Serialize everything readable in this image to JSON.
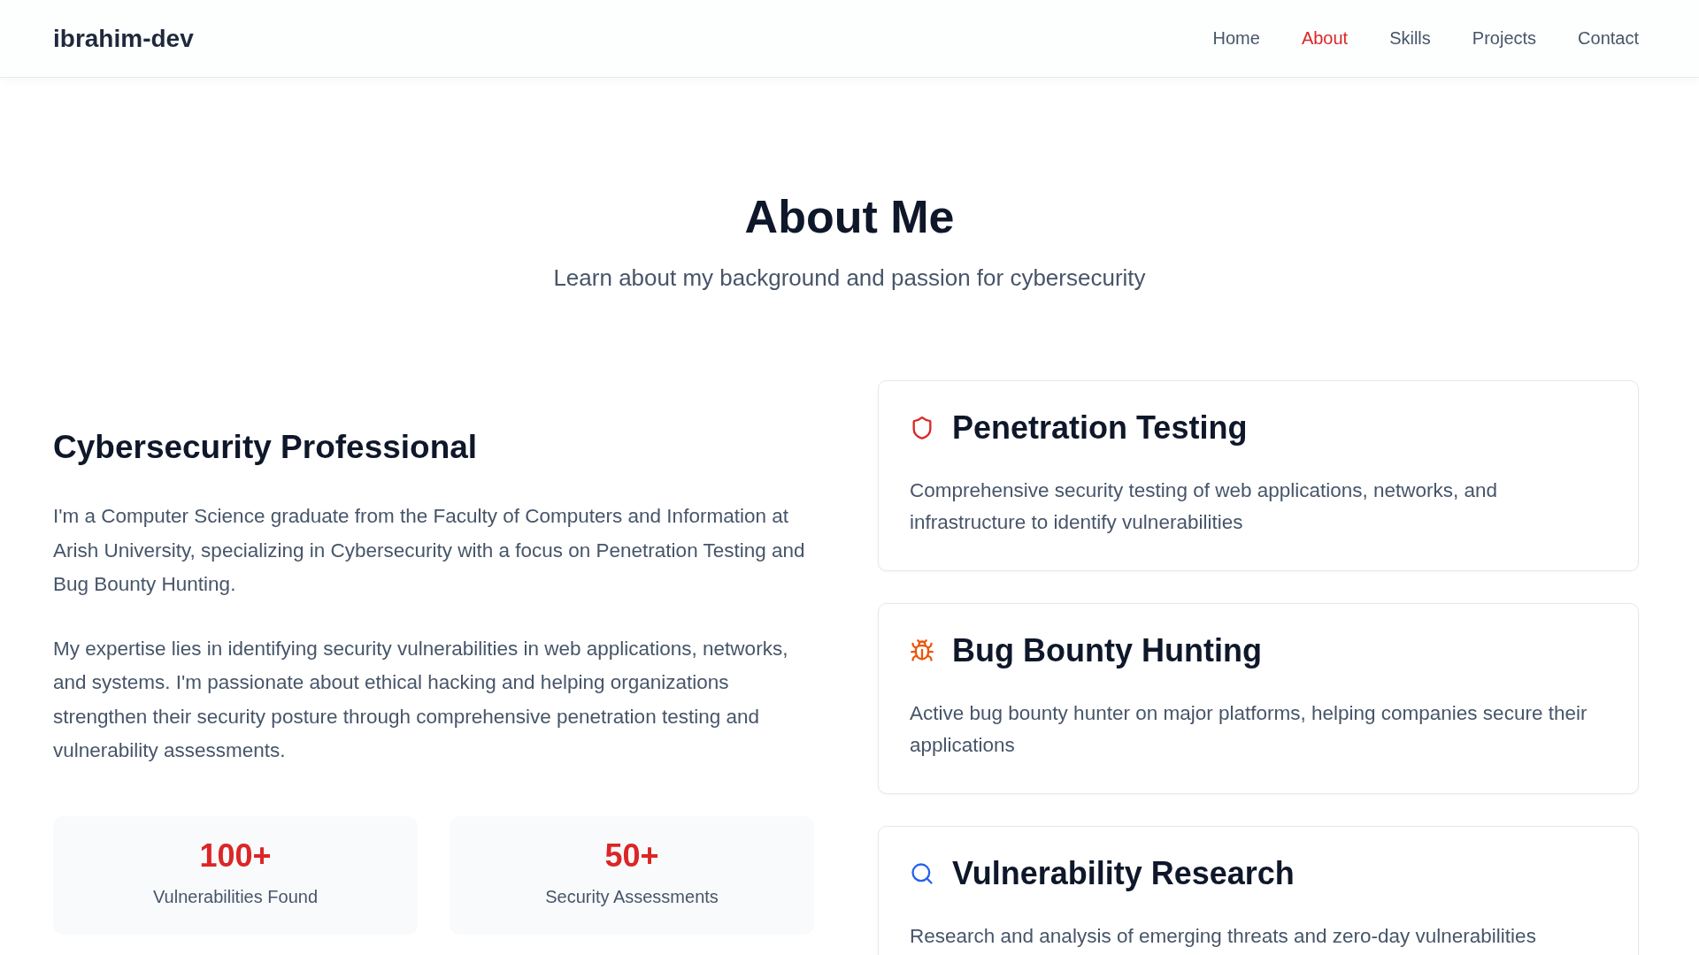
{
  "header": {
    "logo": "ibrahim-dev",
    "nav": [
      {
        "label": "Home",
        "selected": false
      },
      {
        "label": "About",
        "selected": true
      },
      {
        "label": "Skills",
        "selected": false
      },
      {
        "label": "Projects",
        "selected": false
      },
      {
        "label": "Contact",
        "selected": false
      }
    ]
  },
  "hero": {
    "title": "About Me",
    "subtitle": "Learn about my background and passion for cybersecurity"
  },
  "intro": {
    "heading": "Cybersecurity Professional",
    "paragraphs": [
      "I'm a Computer Science graduate from the Faculty of Computers and Information at Arish University, specializing in Cybersecurity with a focus on Penetration Testing and Bug Bounty Hunting.",
      "My expertise lies in identifying security vulnerabilities in web applications, networks, and systems. I'm passionate about ethical hacking and helping organizations strengthen their security posture through comprehensive penetration testing and vulnerability assessments."
    ],
    "stats": [
      {
        "value": "100+",
        "label": "Vulnerabilities Found"
      },
      {
        "value": "50+",
        "label": "Security Assessments"
      }
    ]
  },
  "services": [
    {
      "kind": "shield",
      "title": "Penetration Testing",
      "description": "Comprehensive security testing of web applications, networks, and infrastructure to identify vulnerabilities",
      "color": "#dc2626"
    },
    {
      "kind": "bug",
      "title": "Bug Bounty Hunting",
      "description": "Active bug bounty hunter on major platforms, helping companies secure their applications",
      "color": "#ea580c"
    },
    {
      "kind": "search",
      "title": "Vulnerability Research",
      "description": "Research and analysis of emerging threats and zero-day vulnerabilities",
      "color": "#2563eb"
    }
  ]
}
